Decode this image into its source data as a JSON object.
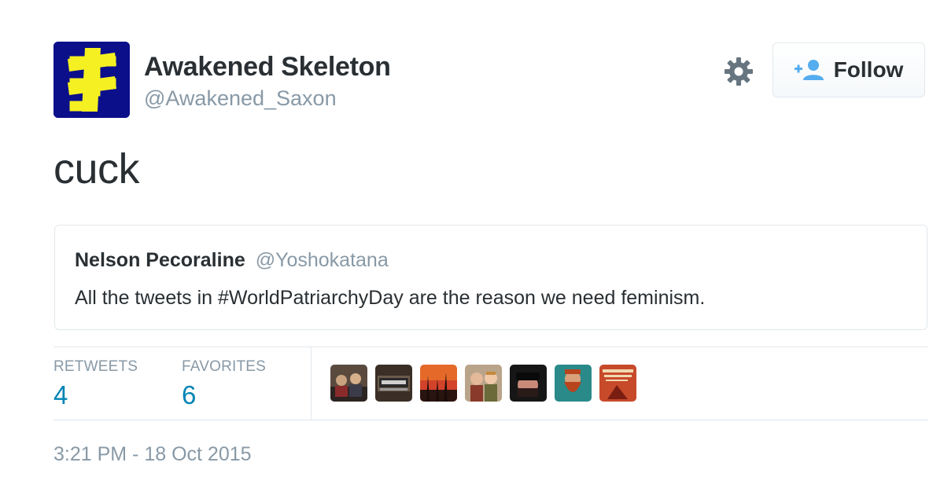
{
  "author": {
    "display_name": "Awakened Skeleton",
    "handle": "@Awakened_Saxon",
    "avatar_icon": "yellow-rune-on-blue-avatar"
  },
  "actions": {
    "settings_icon": "gear-icon",
    "follow_label": "Follow",
    "follow_icon": "add-user-icon",
    "accent_color": "#55acee"
  },
  "tweet": {
    "text": "cuck"
  },
  "quoted_tweet": {
    "name": "Nelson Pecoraline",
    "handle": "@Yoshokatana",
    "text": "All the tweets in #WorldPatriarchyDay are the reason we need feminism."
  },
  "stats": {
    "retweets_label": "RETWEETS",
    "retweets_count": "4",
    "favorites_label": "FAVORITES",
    "favorites_count": "6",
    "count_color": "#0084b4"
  },
  "favoriters": [
    {
      "icon": "group-photo-avatar"
    },
    {
      "icon": "awesome-sign-avatar"
    },
    {
      "icon": "sunset-trees-avatar"
    },
    {
      "icon": "couple-photo-avatar"
    },
    {
      "icon": "man-with-cap-avatar"
    },
    {
      "icon": "bearded-warrior-avatar"
    },
    {
      "icon": "book-cover-avatar"
    }
  ],
  "timestamp": "3:21 PM - 18 Oct 2015"
}
